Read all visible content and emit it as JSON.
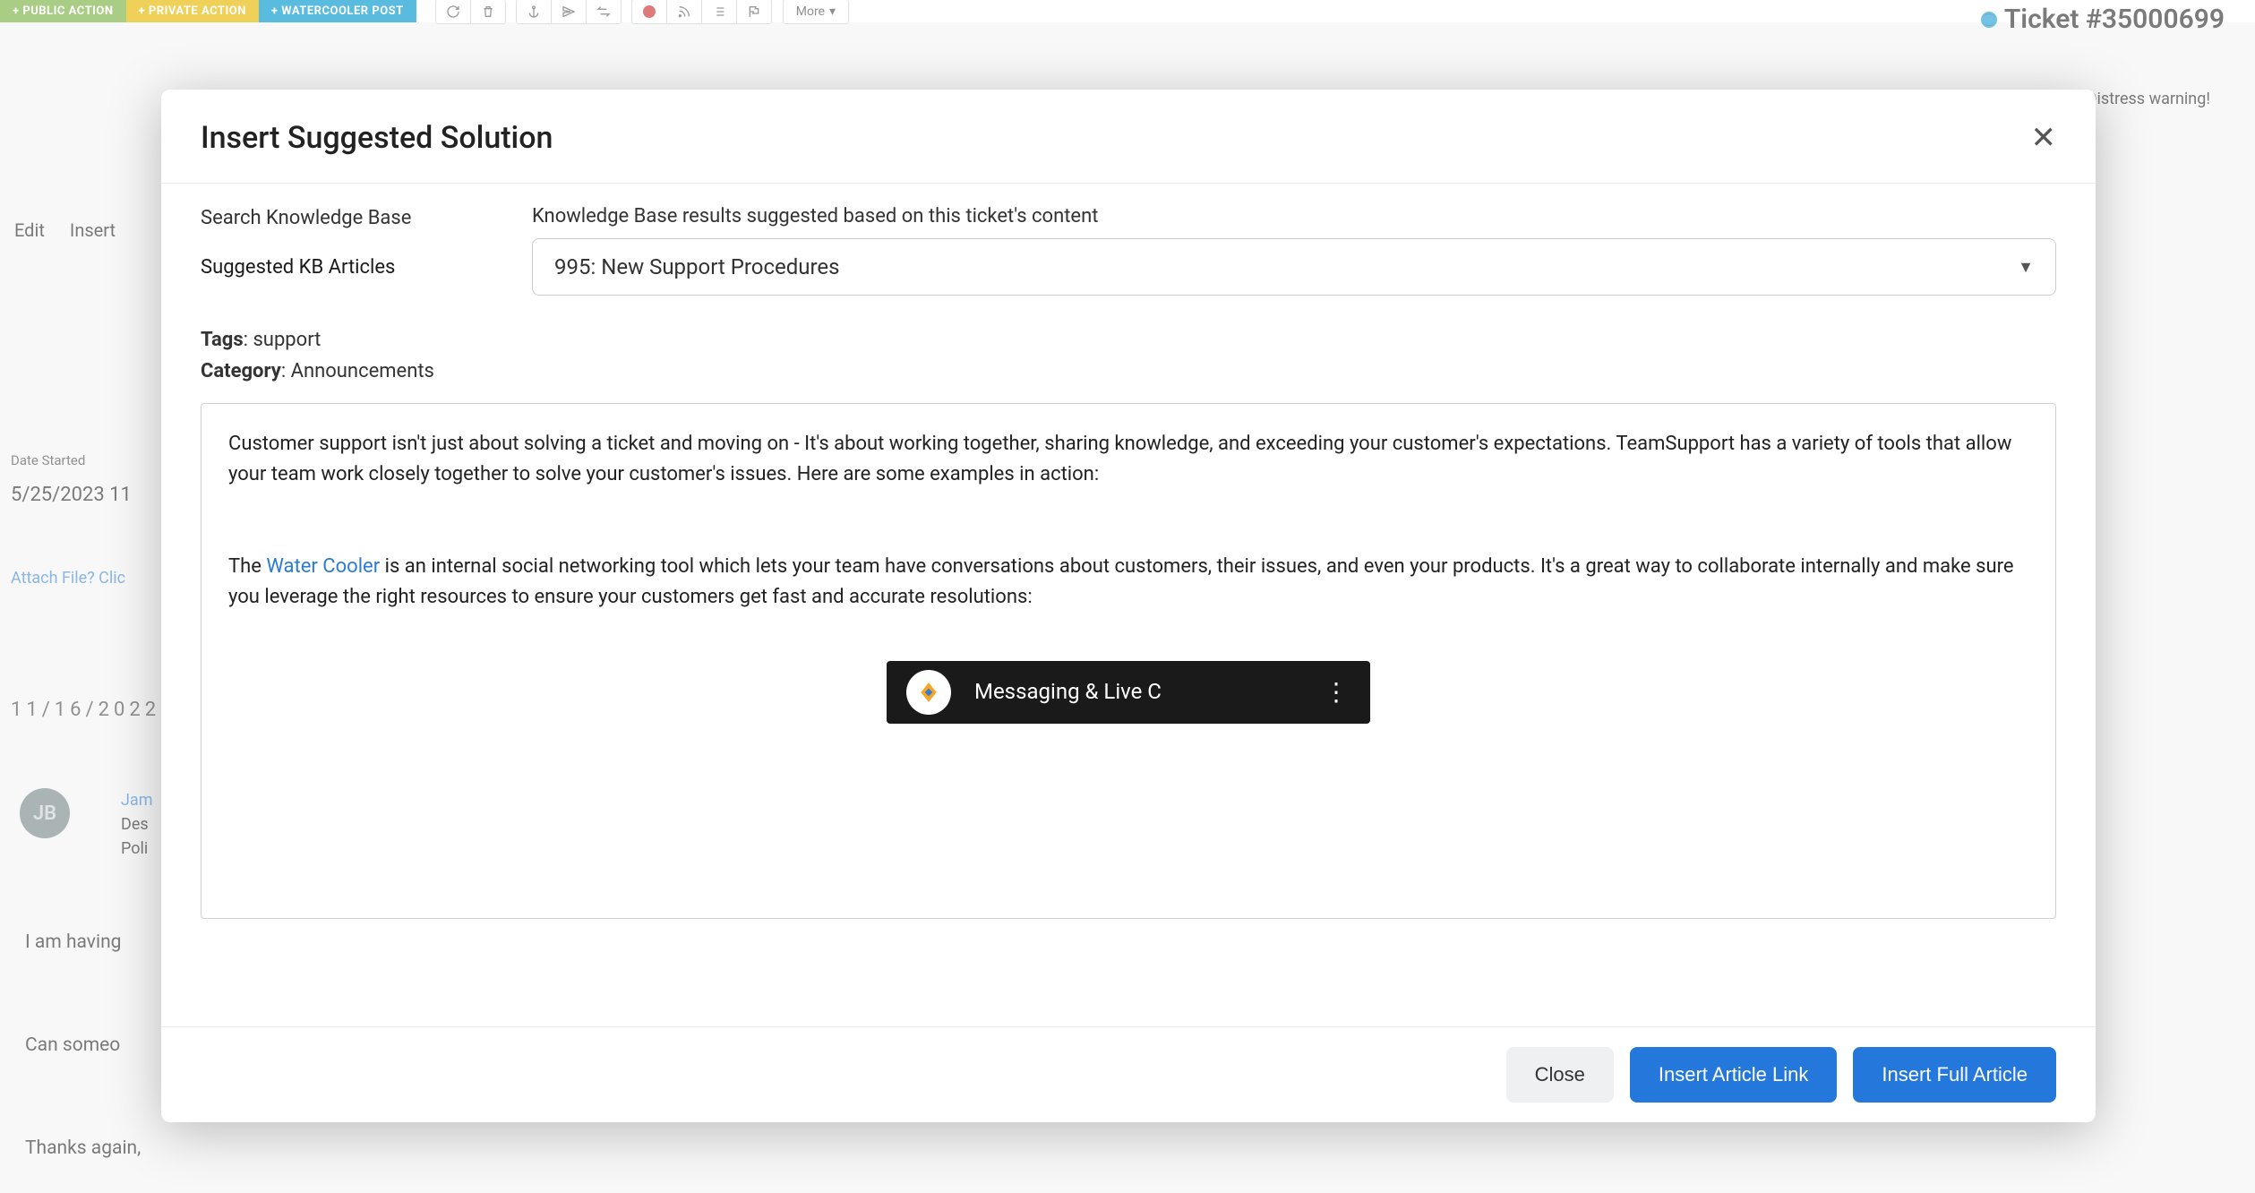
{
  "toolbar": {
    "public_action": "+ PUBLIC ACTION",
    "private_action": "+ PRIVATE ACTION",
    "watercooler_post": "+ WATERCOOLER POST",
    "more": "More",
    "ticket_label": "Ticket #35000699"
  },
  "bg": {
    "distress": "Distress warning!",
    "edit": "Edit",
    "insert_menu": "Insert",
    "date_started_label": "Date Started",
    "date_started_value": "5/25/2023 11",
    "attach": "Attach File? Clic",
    "date_header": "11/16/2022",
    "avatar": "JB",
    "name_fragment": "Jam",
    "desc_fragment": "Des",
    "poli_fragment": "Poli",
    "line1": "I am having",
    "line2": "Can someo",
    "line3": "Thanks again,"
  },
  "modal": {
    "title": "Insert Suggested Solution",
    "left_items": [
      "Search Knowledge Base",
      "Suggested KB Articles"
    ],
    "kb_results_label": "Knowledge Base results suggested based on this ticket's content",
    "kb_selected": "995: New Support Procedures",
    "tags_label": "Tags",
    "tags_value": ": support",
    "category_label": "Category",
    "category_value": ": Announcements",
    "article_p1": "Customer support isn't just about solving a ticket and moving on - It's about working together, sharing knowledge, and exceeding your customer's expectations.  TeamSupport has a variety of tools that allow your team work closely together to solve your customer's issues. Here are some examples in action:",
    "article_the": "The ",
    "article_link": "Water Cooler",
    "article_p2": " is an internal social networking tool which lets your team have conversations about customers, their issues, and even your products.  It's a great way to collaborate internally and make sure you leverage the right resources to ensure your customers get fast and accurate resolutions:",
    "video_title": "Messaging & Live C",
    "close": "Close",
    "insert_link": "Insert Article Link",
    "insert_full": "Insert Full Article"
  }
}
